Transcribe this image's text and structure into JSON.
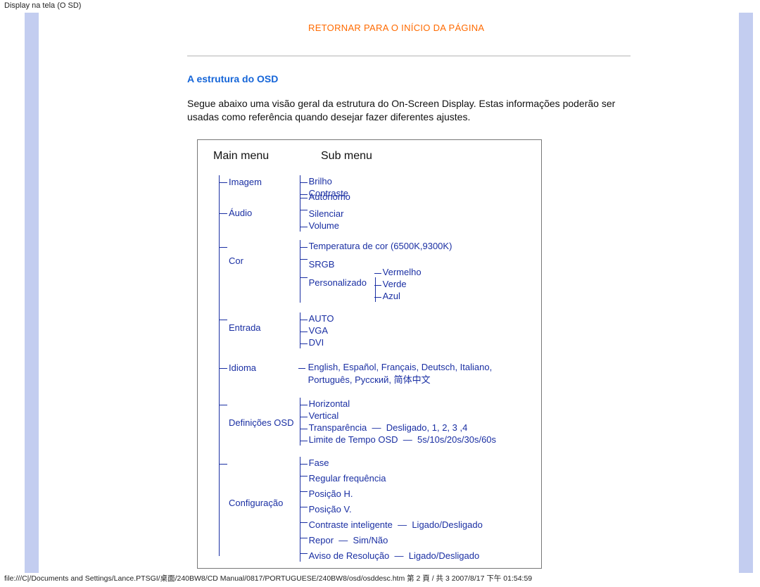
{
  "page_title": "Display na tela (O SD)",
  "footer": "file:///C|/Documents and Settings/Lance.PTSGI/桌面/240BW8/CD Manual/0817/PORTUGUESE/240BW8/osd/osddesc.htm 第 2 頁 / 共 3 2007/8/17 下午 01:54:59",
  "top_link": "RETORNAR PARA O INÍCIO DA PÁGINA",
  "section_title": "A estrutura do OSD",
  "body_text": "Segue abaixo uma visão geral da estrutura do On-Screen Display. Estas informações poderão ser usadas como referência quando desejar fazer diferentes ajustes.",
  "headers": {
    "main": "Main menu",
    "sub": "Sub menu"
  },
  "menu": [
    {
      "main": "Imagem",
      "sub": [
        "Brilho",
        "Contraste"
      ]
    },
    {
      "main": "Áudio",
      "sub_top": "Autónomo",
      "sub": [
        "Silenciar",
        "Volume"
      ]
    },
    {
      "main": "Cor",
      "sub": [
        {
          "t": "Temperatura de cor (6500K,9300K)"
        },
        {
          "t": "SRGB"
        },
        {
          "t": "Personalizado",
          "children": [
            "Vermelho",
            "Verde",
            "Azul"
          ]
        }
      ]
    },
    {
      "main": "Entrada",
      "sub": [
        "AUTO",
        "VGA",
        "DVI"
      ]
    },
    {
      "main": "Idioma",
      "sub_plain": "English, Español, Français, Deutsch, Italiano, Português, Русский, 简体中文"
    },
    {
      "main": "Definições OSD",
      "sub": [
        {
          "t": "Horizontal"
        },
        {
          "t": "Vertical"
        },
        {
          "t": "Transparência",
          "extra": "Desligado, 1, 2, 3 ,4"
        },
        {
          "t": "Limite de Tempo OSD",
          "extra": "5s/10s/20s/30s/60s"
        }
      ]
    },
    {
      "main": "Configuração",
      "sub": [
        {
          "t": "Fase"
        },
        {
          "t": "Regular frequência"
        },
        {
          "t": "Posição H."
        },
        {
          "t": "Posição V."
        },
        {
          "t": "Contraste inteligente",
          "extra": "Ligado/Desligado"
        },
        {
          "t": "Repor",
          "extra": "Sim/Não"
        },
        {
          "t": "Aviso de Resolução",
          "extra": "Ligado/Desligado"
        }
      ]
    }
  ]
}
